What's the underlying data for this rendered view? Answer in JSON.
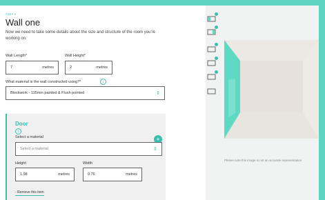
{
  "step": {
    "label": "STEP 5"
  },
  "wall": {
    "title": "Wall one",
    "description": "Now we need to take some details about the size and structure of the room you're working on."
  },
  "wall_length": {
    "label": "Wall Length*",
    "value": "7",
    "unit": "metres"
  },
  "wall_height": {
    "label": "Wall Height*",
    "value": "2",
    "unit": "metres"
  },
  "material": {
    "question": "What material is the wall constructed using?*",
    "selected": "Blockwork - 115mm painted & Flush pointed"
  },
  "door": {
    "title": "Door",
    "select_label": "Select a material",
    "select_placeholder": "Select a material",
    "height_label": "Height",
    "height_value": "1.98",
    "height_unit": "metres",
    "width_label": "Width",
    "width_value": "0.76",
    "width_unit": "metres",
    "remove_label": "- Remove this item"
  },
  "preview": {
    "note": "Please note this image is not an accurate representation"
  },
  "colors": {
    "accent": "#39c0ad",
    "wall_highlight": "#5ed9c3",
    "background": "#f1f3f3"
  }
}
